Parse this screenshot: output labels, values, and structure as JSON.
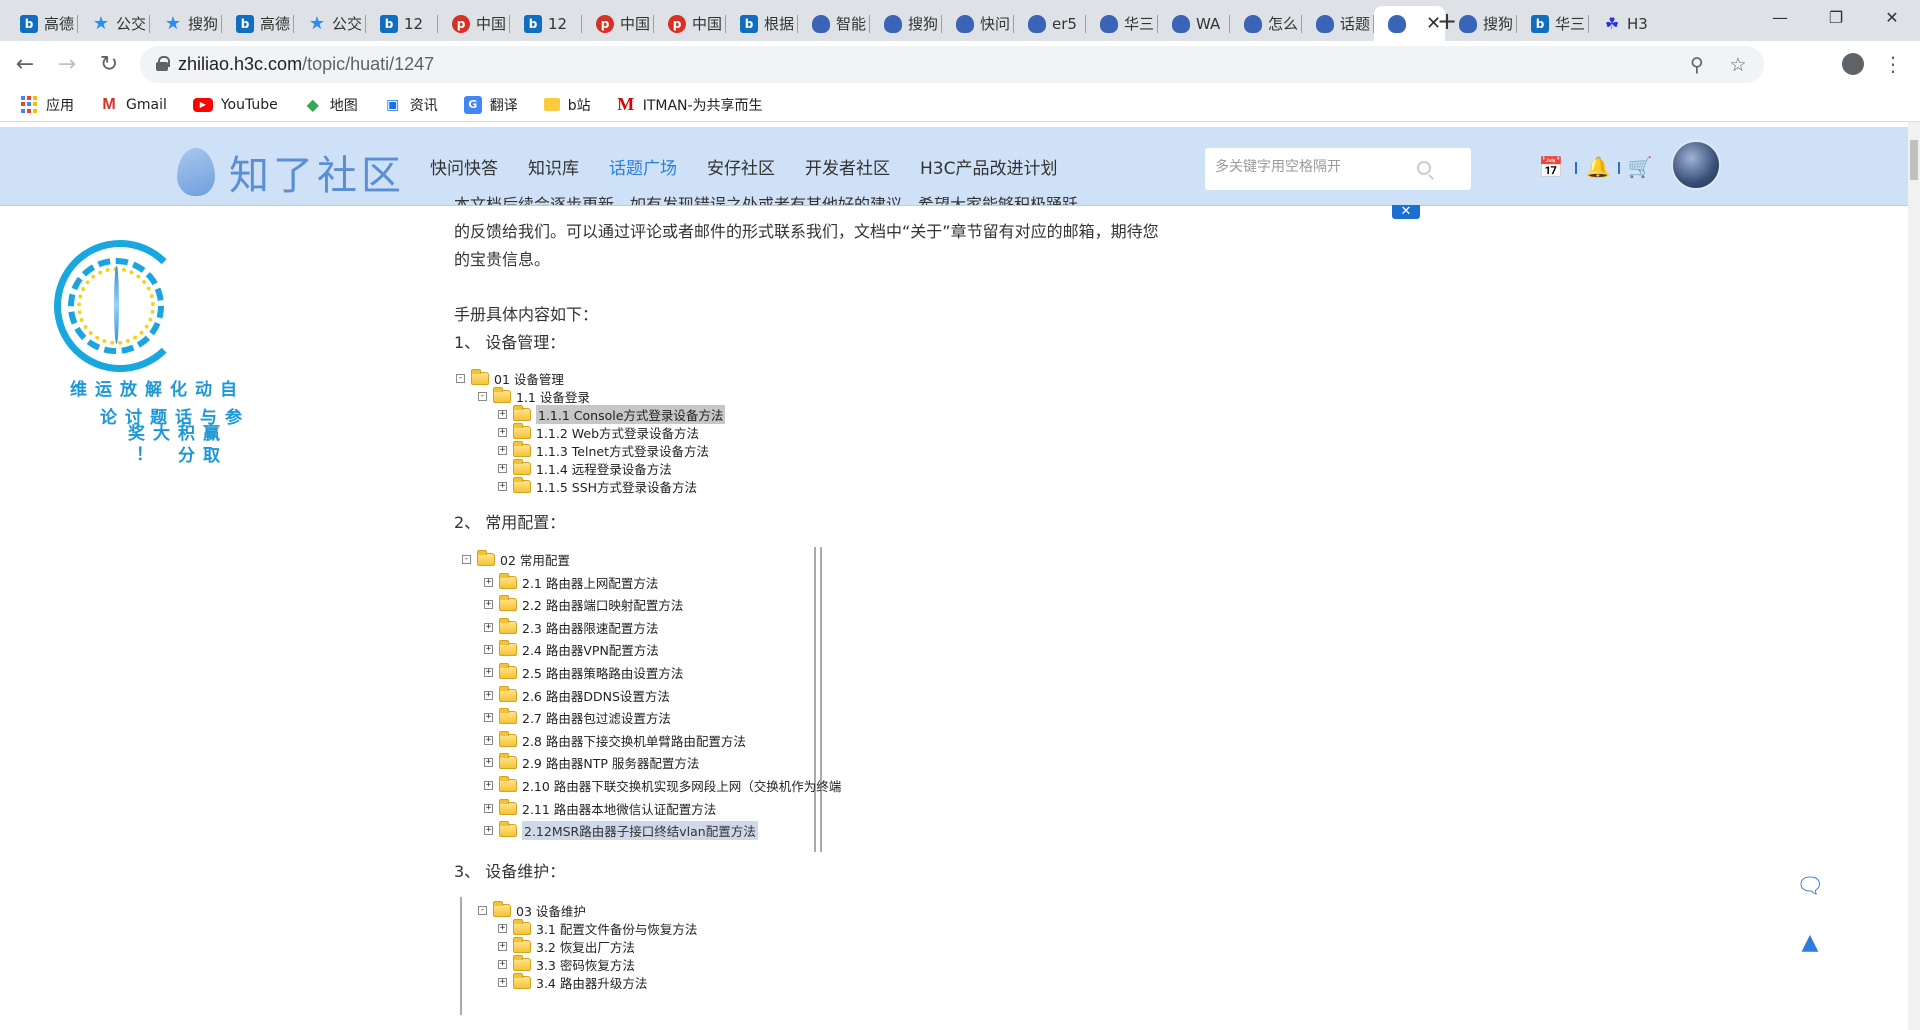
{
  "browser": {
    "tabs": [
      {
        "icon": "bing-icon",
        "title": "高德"
      },
      {
        "icon": "star-icon",
        "title": "公交"
      },
      {
        "icon": "star-icon",
        "title": "搜狗"
      },
      {
        "icon": "bing-icon",
        "title": "高德"
      },
      {
        "icon": "star-icon",
        "title": "公交"
      },
      {
        "icon": "bing-icon",
        "title": "12"
      },
      {
        "icon": "pinterest-icon",
        "title": "中国"
      },
      {
        "icon": "bing-icon",
        "title": "12"
      },
      {
        "icon": "pinterest-icon",
        "title": "中国"
      },
      {
        "icon": "pinterest-icon",
        "title": "中国"
      },
      {
        "icon": "bing-icon",
        "title": "根据"
      },
      {
        "icon": "zhiliao-icon",
        "title": "智能"
      },
      {
        "icon": "zhiliao-icon",
        "title": "搜狗"
      },
      {
        "icon": "zhiliao-icon",
        "title": "快问"
      },
      {
        "icon": "zhiliao-icon",
        "title": "er5"
      },
      {
        "icon": "zhiliao-icon",
        "title": "华三"
      },
      {
        "icon": "zhiliao-icon",
        "title": "WA"
      },
      {
        "icon": "zhiliao-icon",
        "title": "怎么"
      },
      {
        "icon": "zhiliao-icon",
        "title": "话题"
      },
      {
        "icon": "zhiliao-icon",
        "title": "",
        "active": true
      },
      {
        "icon": "zhiliao-icon",
        "title": "搜狗"
      },
      {
        "icon": "bing-icon",
        "title": "华三"
      },
      {
        "icon": "baidu-icon",
        "title": "H3"
      }
    ],
    "url_host": "zhiliao.h3c.com",
    "url_path": "/topic/huati/1247",
    "bookmarks": [
      {
        "icon": "apps-icon",
        "label": "应用"
      },
      {
        "icon": "gmail-icon",
        "label": "Gmail"
      },
      {
        "icon": "youtube-icon",
        "label": "YouTube"
      },
      {
        "icon": "maps-icon",
        "label": "地图"
      },
      {
        "icon": "news-icon",
        "label": "资讯"
      },
      {
        "icon": "translate-icon",
        "label": "翻译"
      },
      {
        "icon": "folder-icon",
        "label": "b站"
      },
      {
        "icon": "itman-icon",
        "label": "ITMAN-为共享而生"
      }
    ]
  },
  "site": {
    "logo_text": "知了社区",
    "nav": [
      "快问快答",
      "知识库",
      "话题广场",
      "安仔社区",
      "开发者社区",
      "H3C产品改进计划"
    ],
    "active_nav": "话题广场",
    "search_placeholder": "多关键字用空格隔开",
    "accent": "#2b7de0",
    "header_bg": "#cfe1f6"
  },
  "promo": {
    "col1": "自动化解放运维",
    "col2": "参与话题讨论",
    "col3": "赢取积分大奖！"
  },
  "article": {
    "partial_line": "本文档后续会逐步更新。如有发现错误之处或者有其他好的建议，希望大家能够积极踊跃",
    "para_line2": "的反馈给我们。可以通过评论或者邮件的形式联系我们，文档中“关于”章节留有对应的邮箱，期待您",
    "para_line3": "的宝贵信息。",
    "intro": "手册具体内容如下：",
    "sections": [
      {
        "heading": "1、  设备管理：",
        "root": "01 设备管理",
        "sub": "1.1 设备登录",
        "items": [
          "1.1.1 Console方式登录设备方法",
          "1.1.2 Web方式登录设备方法",
          "1.1.3 Telnet方式登录设备方法",
          "1.1.4 远程登录设备方法",
          "1.1.5 SSH方式登录设备方法"
        ]
      },
      {
        "heading": "2、  常用配置：",
        "root": "02 常用配置",
        "items": [
          "2.1 路由器上网配置方法",
          "2.2 路由器端口映射配置方法",
          "2.3 路由器限速配置方法",
          "2.4 路由器VPN配置方法",
          "2.5 路由器策略路由设置方法",
          "2.6 路由器DDNS设置方法",
          "2.7 路由器包过滤设置方法",
          "2.8 路由器下接交换机单臂路由配置方法",
          "2.9 路由器NTP 服务器配置方法",
          "2.10 路由器下联交换机实现多网段上网（交换机作为终端",
          "2.11 路由器本地微信认证配置方法",
          "2.12MSR路由器子接口终结vlan配置方法"
        ]
      },
      {
        "heading": "3、  设备维护：",
        "root": "03 设备维护",
        "items": [
          "3.1 配置文件备份与恢复方法",
          "3.2 恢复出厂方法",
          "3.3 密码恢复方法",
          "3.4 路由器升级方法"
        ]
      }
    ]
  }
}
